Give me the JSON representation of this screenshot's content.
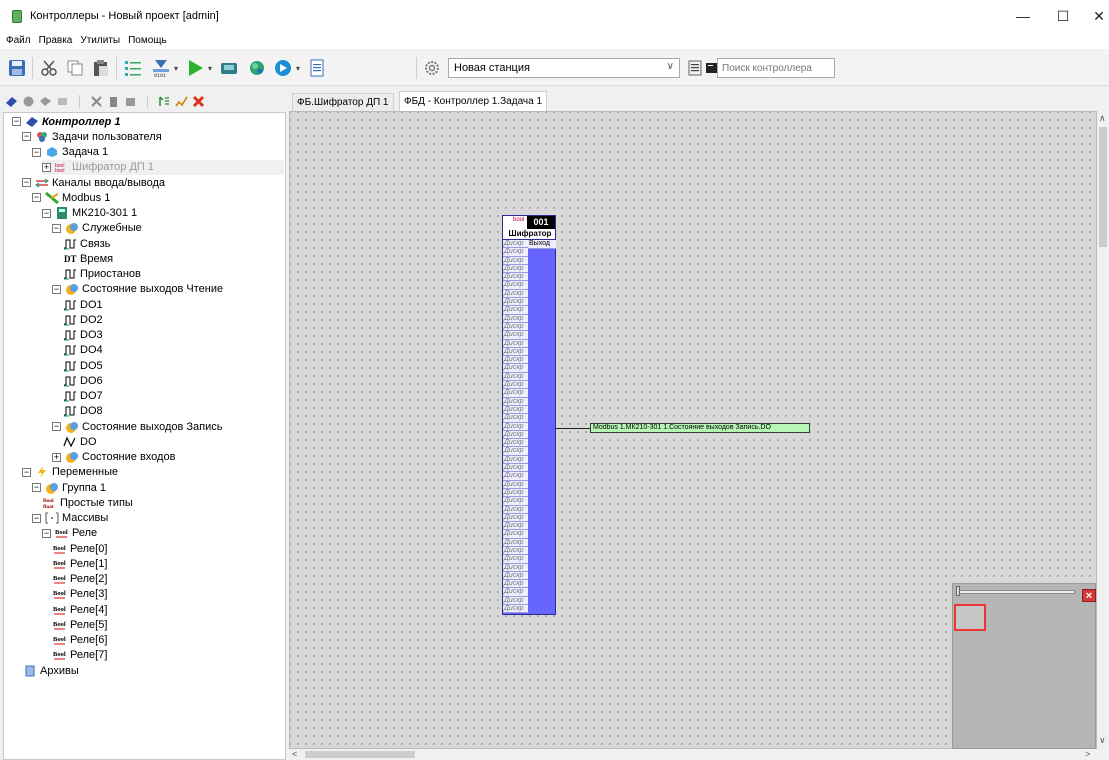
{
  "window": {
    "title": "Контроллеры - Новый проект [admin]",
    "minimize": "—",
    "maximize": "☐",
    "close": "✕"
  },
  "menu": [
    "Файл",
    "Правка",
    "Утилиты",
    "Помощь"
  ],
  "toolbar": {
    "station": "Новая станция",
    "search_placeholder": "Поиск контроллера"
  },
  "tabs": [
    {
      "label": "ФБ.Шифратор ДП 1"
    },
    {
      "label": "ФБД - Контроллер 1.Задача 1"
    }
  ],
  "tree": [
    {
      "label": "Контроллер 1",
      "exp": "−",
      "icon": "controller-icon",
      "bold": true,
      "italic": true
    },
    {
      "label": "Задачи пользователя",
      "exp": "−",
      "icon": "tasks-icon"
    },
    {
      "label": "Задача 1",
      "exp": "−",
      "icon": "task-icon"
    },
    {
      "label": "Шифратор ДП 1",
      "exp": "+",
      "icon": "function-block-icon",
      "muted": true
    },
    {
      "label": "Каналы ввода/вывода",
      "exp": "−",
      "icon": "io-channels-icon"
    },
    {
      "label": "Modbus 1",
      "exp": "−",
      "icon": "modbus-icon"
    },
    {
      "label": "МК210-301 1",
      "exp": "−",
      "icon": "device-icon"
    },
    {
      "label": "Служебные",
      "exp": "−",
      "icon": "folder-icon"
    },
    {
      "label": "Связь",
      "icon": "pulse-icon"
    },
    {
      "label": "Время",
      "icon": "datetime-icon"
    },
    {
      "label": "Приостанов",
      "icon": "pulse-icon"
    },
    {
      "label": "Состояние выходов Чтение",
      "exp": "−",
      "icon": "folder-icon"
    },
    {
      "label": "DO1",
      "icon": "pulse-icon"
    },
    {
      "label": "DO2",
      "icon": "pulse-icon"
    },
    {
      "label": "DO3",
      "icon": "pulse-icon"
    },
    {
      "label": "DO4",
      "icon": "pulse-icon"
    },
    {
      "label": "DO5",
      "icon": "pulse-icon"
    },
    {
      "label": "DO6",
      "icon": "pulse-icon"
    },
    {
      "label": "DO7",
      "icon": "pulse-icon"
    },
    {
      "label": "DO8",
      "icon": "pulse-icon"
    },
    {
      "label": "Состояние выходов Запись",
      "exp": "−",
      "icon": "folder-icon"
    },
    {
      "label": "DO",
      "icon": "analog-icon"
    },
    {
      "label": "Состояние входов",
      "exp": "+",
      "icon": "folder-icon"
    },
    {
      "label": "Переменные",
      "exp": "−",
      "icon": "variables-icon"
    },
    {
      "label": "Группа 1",
      "exp": "−",
      "icon": "folder-icon"
    },
    {
      "label": "Простые типы",
      "icon": "bool-float-icon"
    },
    {
      "label": "Массивы",
      "exp": "−",
      "icon": "array-icon"
    },
    {
      "label": "Реле",
      "exp": "−",
      "icon": "bool-icon"
    },
    {
      "label": "Реле[0]",
      "icon": "bool-icon"
    },
    {
      "label": "Реле[1]",
      "icon": "bool-icon"
    },
    {
      "label": "Реле[2]",
      "icon": "bool-icon"
    },
    {
      "label": "Реле[3]",
      "icon": "bool-icon"
    },
    {
      "label": "Реле[4]",
      "icon": "bool-icon"
    },
    {
      "label": "Реле[5]",
      "icon": "bool-icon"
    },
    {
      "label": "Реле[6]",
      "icon": "bool-icon"
    },
    {
      "label": "Реле[7]",
      "icon": "bool-icon"
    },
    {
      "label": "Архивы",
      "icon": "archive-icon"
    }
  ],
  "block": {
    "number": "001",
    "name": "Шифратор",
    "icon_text": "bool",
    "input_label": "Дискр",
    "input_count": 45,
    "output_label": "Выход",
    "link": "Modbus 1.МК210-301 1.Состояние выходов Запись.DO"
  },
  "colors": {
    "block_fill": "#6666ff",
    "link_fill": "#b6f7b6",
    "canvas": "#d8d8d8"
  }
}
